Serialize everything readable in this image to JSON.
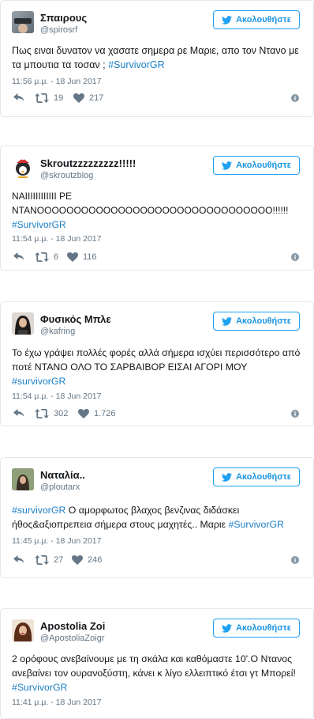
{
  "ui": {
    "accent": "#1da1f2",
    "muted": "#657786",
    "hashtag_color": "#1b7fc5"
  },
  "tweets": [
    {
      "name": "Σπαιρους",
      "handle": "@spirosrf",
      "follow_label": "Ακολουθήστε",
      "text": "Πως ειναι δυνατον να χασατε σημερα ρε Μαριε, απο τον Ντανο με τα μπουτια τα τοσαν ; ",
      "hashtags": [
        "#SurvivorGR"
      ],
      "time": "11:56 μ.μ. - 18 Jun 2017",
      "retweets": "19",
      "likes": "217"
    },
    {
      "name": "Skroutzzzzzzzzz!!!!!",
      "handle": "@skroutzblog",
      "follow_label": "Ακολουθήστε",
      "text_line1": "ΝΑΙΙΙΙΙΙΙΙΙΙΙΙ ΡΕ",
      "text_line2": "ΝΤΑΝΟΟΟΟΟΟΟΟΟΟΟΟΟΟΟΟΟΟΟΟΟΟΟΟΟΟΟΟΟΟΟΟ!!!!!!",
      "hashtags": [
        "#SurvivorGR"
      ],
      "time": "11:54 μ.μ. - 18 Jun 2017",
      "retweets": "6",
      "likes": "116"
    },
    {
      "name": "Φυσικός Μπλε",
      "handle": "@kafring",
      "follow_label": "Ακολουθήστε",
      "text": "Το έχω γράψει πολλές φορές αλλά σήμερα ισχύει περισσότερο από ποτέ ΝΤΑΝΟ ΟΛΟ ΤΟ ΣΑΡΒΑΙΒΟΡ ΕΙΣΑΙ ΑΓΟΡΙ ΜΟΥ ",
      "hashtags": [
        "#survivorGR"
      ],
      "time": "11:54 μ.μ. - 18 Jun 2017",
      "retweets": "302",
      "likes": "1.726"
    },
    {
      "name": "Ναταλία..",
      "handle": "@ploutarx",
      "follow_label": "Ακολουθήστε",
      "text_pre": "",
      "text": " Ο αμορφωτος βλαχος βενζινας διδάσκει ήθος&αξιοπρεπεια σήμερα στους μαχητές.. Μαριε ",
      "hashtags": [
        "#survivorGR",
        "#SurvivorGR"
      ],
      "time": "11:45 μ.μ. - 18 Jun 2017",
      "retweets": "27",
      "likes": "246"
    },
    {
      "name": "Apostolia Zoi",
      "handle": "@ApostoliaZoigr",
      "follow_label": "Ακολουθήστε",
      "text": "2 ορόφους ανεβαίνουμε με τη σκάλα και καθόμαστε 10'.Ο Ντανος ανεβαίνει τον ουρανοξύστη, κάνει κ λίγο ελλειπτικό έτσι γτ Μπορεί! ",
      "hashtags": [
        "#SurvivorGR"
      ],
      "time": "11:41 μ.μ. - 18 Jun 2017"
    }
  ]
}
